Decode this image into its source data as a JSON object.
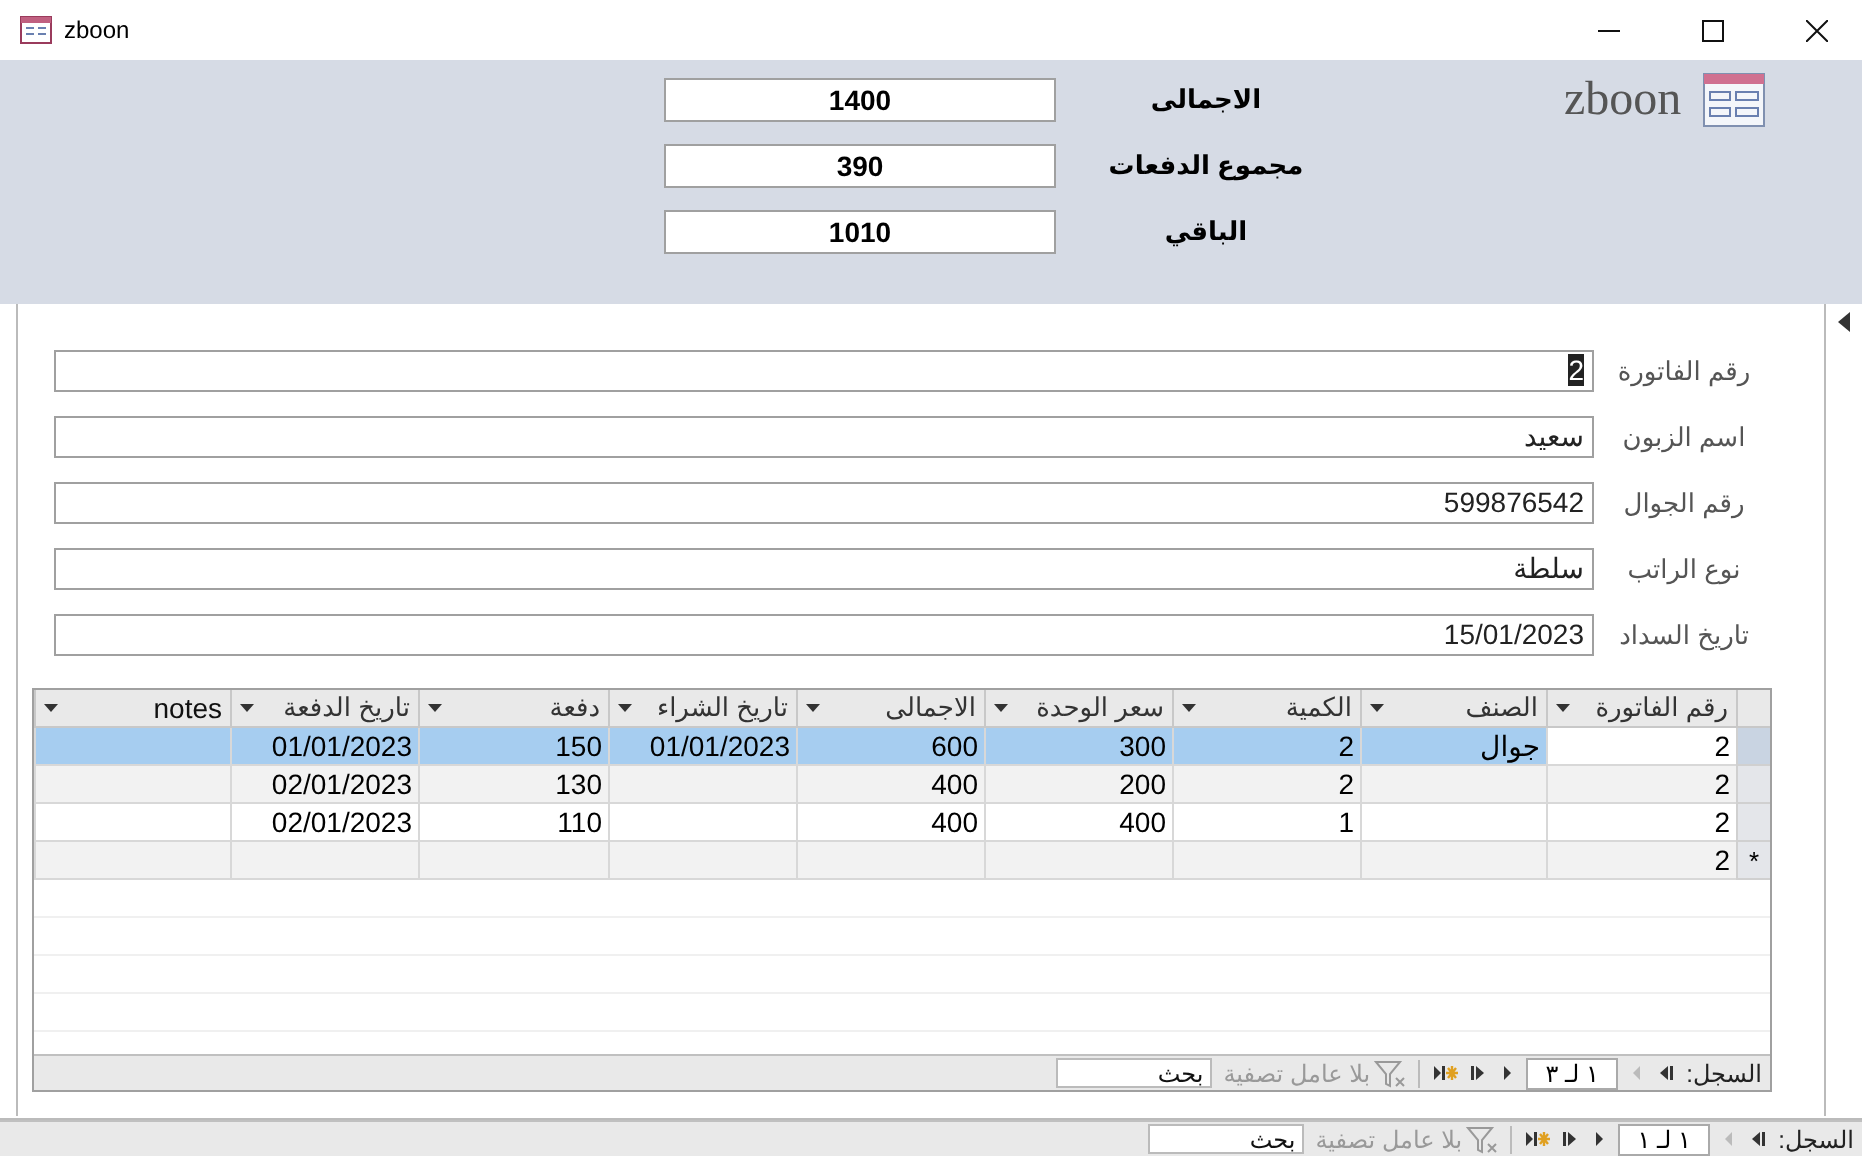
{
  "window": {
    "title": "zboon"
  },
  "header": {
    "logo_text": "zboon",
    "totals": [
      {
        "label": "الاجمالى",
        "value": "1400"
      },
      {
        "label": "مجموع الدفعات",
        "value": "390"
      },
      {
        "label": "الباقي",
        "value": "1010"
      }
    ]
  },
  "form": {
    "fields": [
      {
        "label": "رقم الفاتورة",
        "value": "2",
        "focused": true
      },
      {
        "label": "اسم الزبون",
        "value": "سعيد",
        "focused": false
      },
      {
        "label": "رقم الجوال",
        "value": "599876542",
        "focused": false
      },
      {
        "label": "نوع الراتب",
        "value": "سلطة",
        "focused": false
      },
      {
        "label": "تاريخ السداد",
        "value": "15/01/2023",
        "focused": false
      }
    ]
  },
  "subform": {
    "columns": [
      "رقم الفاتورة",
      "الصنف",
      "الكمية",
      "سعر الوحدة",
      "الاجمالى",
      "تاريخ الشراء",
      "دفعة",
      "تاريخ الدفعة",
      "notes"
    ],
    "rows": [
      {
        "kind": "record",
        "selected": true,
        "cells": [
          "2",
          "جوال",
          "2",
          "300",
          "600",
          "01/01/2023",
          "150",
          "01/01/2023",
          null
        ]
      },
      {
        "kind": "record",
        "selected": false,
        "cells": [
          "2",
          null,
          "2",
          "200",
          "400",
          null,
          "130",
          "02/01/2023",
          null
        ]
      },
      {
        "kind": "record",
        "selected": false,
        "cells": [
          "2",
          null,
          "1",
          "400",
          "400",
          null,
          "110",
          "02/01/2023",
          null
        ]
      },
      {
        "kind": "new",
        "selected": false,
        "marker": "*",
        "cells": [
          "2",
          null,
          null,
          null,
          null,
          null,
          null,
          null,
          null
        ]
      }
    ],
    "navigation": {
      "label": "السجل:",
      "position": "١ لـ ٣",
      "filter": "بلا عامل تصفية",
      "search_placeholder": "بحث"
    }
  },
  "navigation": {
    "label": "السجل:",
    "position": "١ لـ ١",
    "filter": "بلا عامل تصفية",
    "search_placeholder": "بحث"
  }
}
